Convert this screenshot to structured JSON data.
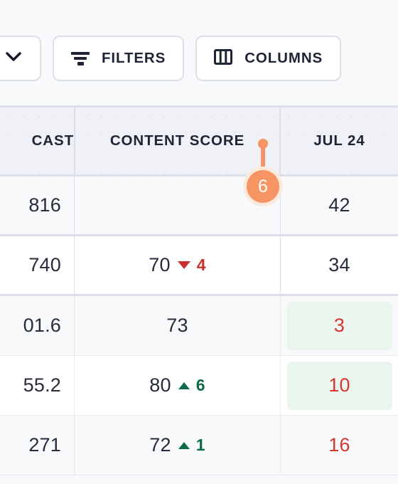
{
  "toolbar": {
    "collapse_button": {
      "icon": "chevron-down-icon",
      "label": ""
    },
    "filters_button": {
      "label": "FILTERS",
      "icon": "filter-icon"
    },
    "columns_button": {
      "label": "COLUMNS",
      "icon": "columns-icon"
    }
  },
  "annotation": {
    "badge_number": "6",
    "color": "#f79463",
    "halo_color": "#fdeadf"
  },
  "colors": {
    "header_bg": "#f0f1f6",
    "row_alt_bg": "#f8f9fb",
    "row_bg": "#ffffff",
    "border": "#dcdfe8",
    "text": "#1f2435",
    "positive": "#0f6b43",
    "negative": "#c9302c",
    "highlight_cell": "#eaf5ee",
    "value_red": "#d6362f"
  },
  "table": {
    "columns": [
      {
        "key": "forecast",
        "label": "CAST",
        "truncated": true
      },
      {
        "key": "content_score",
        "label": "CONTENT SCORE"
      },
      {
        "key": "jul24",
        "label": "JUL 24"
      }
    ],
    "rows": [
      {
        "forecast": "816",
        "score": "",
        "delta": "",
        "delta_dir": "none",
        "jul24": "42",
        "jul24_highlight": false,
        "jul24_red": false,
        "banded": true
      },
      {
        "forecast": "740",
        "score": "70",
        "delta": "4",
        "delta_dir": "down",
        "jul24": "34",
        "jul24_highlight": false,
        "jul24_red": false,
        "banded": false
      },
      {
        "forecast": "01.6",
        "score": "73",
        "delta": "",
        "delta_dir": "none",
        "jul24": "3",
        "jul24_highlight": true,
        "jul24_red": true,
        "banded": true
      },
      {
        "forecast": "55.2",
        "score": "80",
        "delta": "6",
        "delta_dir": "up",
        "jul24": "10",
        "jul24_highlight": true,
        "jul24_red": true,
        "banded": false
      },
      {
        "forecast": "271",
        "score": "72",
        "delta": "1",
        "delta_dir": "up",
        "jul24": "16",
        "jul24_highlight": false,
        "jul24_red": true,
        "banded": true
      }
    ]
  }
}
